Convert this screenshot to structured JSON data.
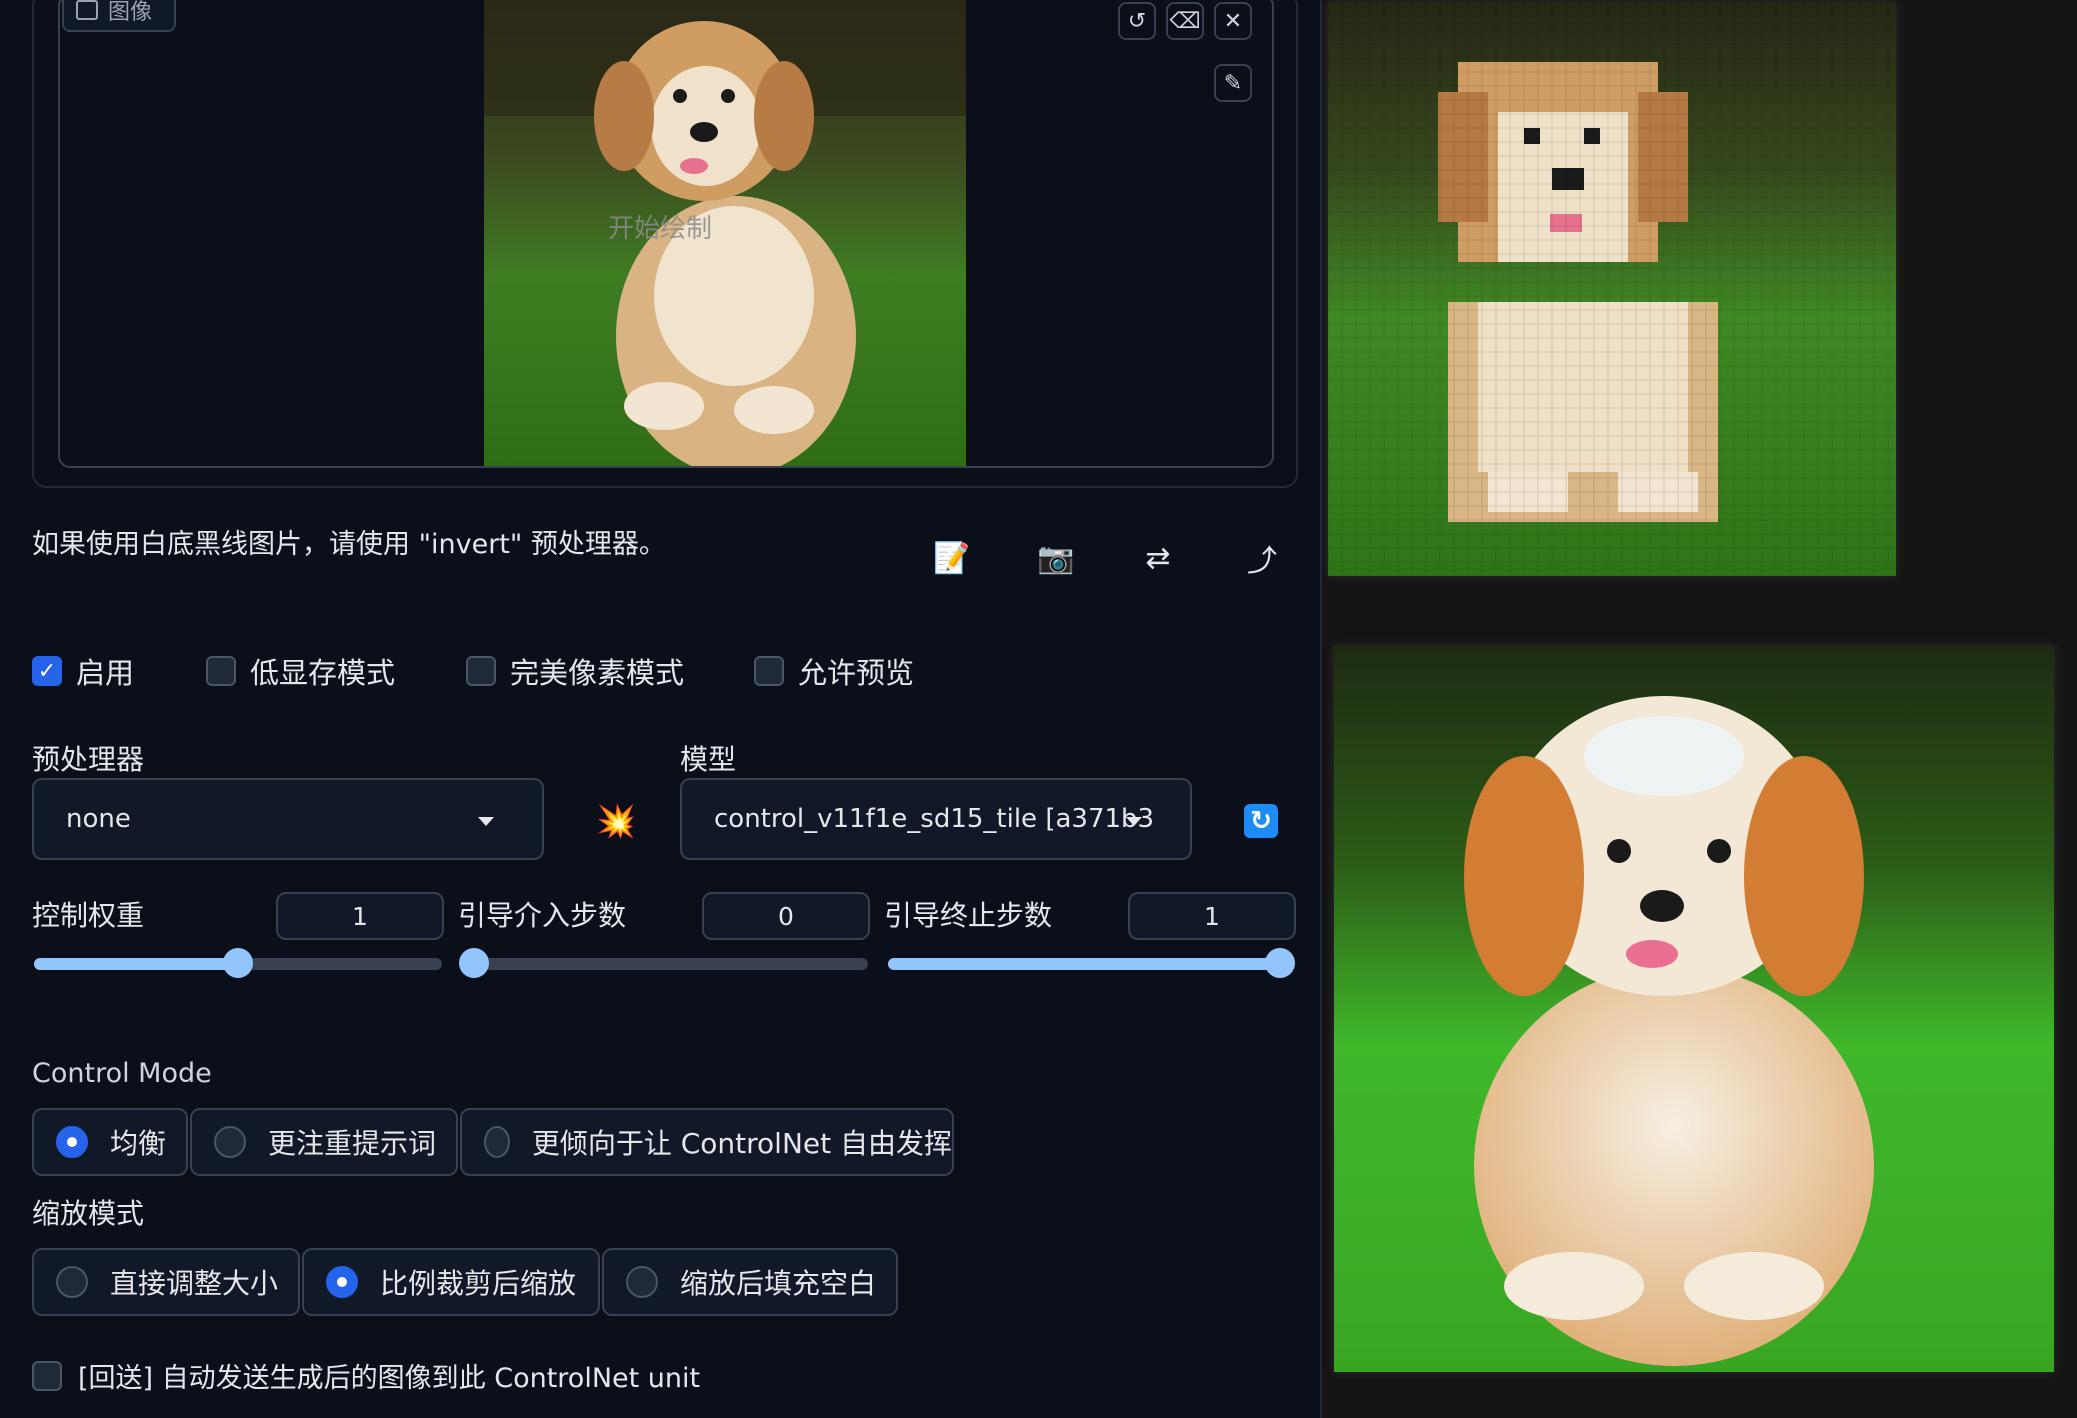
{
  "image_panel": {
    "label": "图像",
    "start_drawing": "开始绘制",
    "tools": [
      "undo-icon",
      "eraser-icon",
      "close-icon",
      "brush-icon"
    ]
  },
  "hint": "如果使用白底黑线图片，请使用 \"invert\" 预处理器。",
  "action_icons": {
    "note": "📝",
    "camera": "📷",
    "swap": "⇄",
    "send": "⤴"
  },
  "checkboxes": [
    {
      "label": "启用",
      "checked": true
    },
    {
      "label": "低显存模式",
      "checked": false
    },
    {
      "label": "完美像素模式",
      "checked": false
    },
    {
      "label": "允许预览",
      "checked": false
    }
  ],
  "preprocessor": {
    "label": "预处理器",
    "value": "none"
  },
  "model": {
    "label": "模型",
    "value": "control_v11f1e_sd15_tile [a371b3"
  },
  "run_preprocessor_icon": "💥",
  "refresh_icon": "🔄",
  "sliders": [
    {
      "label": "控制权重",
      "value": "1",
      "fraction": 0.5
    },
    {
      "label": "引导介入步数",
      "value": "0",
      "fraction": 0.0
    },
    {
      "label": "引导终止步数",
      "value": "1",
      "fraction": 1.0
    }
  ],
  "control_mode": {
    "title": "Control Mode",
    "options": [
      "均衡",
      "更注重提示词",
      "更倾向于让 ControlNet 自由发挥"
    ],
    "selected": 0
  },
  "resize_mode": {
    "title": "缩放模式",
    "options": [
      "直接调整大小",
      "比例裁剪后缩放",
      "缩放后填充空白"
    ],
    "selected": 1
  },
  "loopback": {
    "label": "[回送] 自动发送生成后的图像到此 ControlNet unit",
    "checked": false
  }
}
